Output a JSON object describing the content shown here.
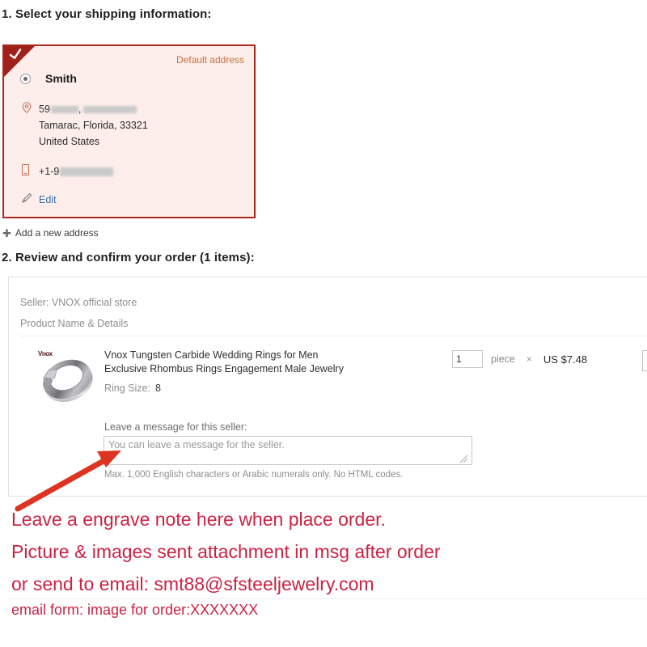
{
  "steps": {
    "step1_heading": "1. Select your shipping information:",
    "step2_heading": "2. Review and confirm your order (1 items):"
  },
  "address_card": {
    "default_badge": "Default address",
    "selected": true,
    "check_icon": "check-icon",
    "recipient": "Smith",
    "street_prefix": "59",
    "city_state_zip": "Tamarac, Florida, 33321",
    "country": "United States",
    "phone_prefix": "+1-9",
    "edit_label": "Edit",
    "location_icon": "location-pin-icon",
    "phone_icon": "mobile-phone-icon",
    "pencil_icon": "pencil-icon",
    "border_color": "#a82a1d",
    "background_color": "#fdeeec",
    "ribbon_color": "#a0201b",
    "badge_color": "#c8703c",
    "link_color": "#3b6ea8"
  },
  "add_address": {
    "label": "Add a new address",
    "icon": "plus-icon"
  },
  "order_panel": {
    "seller": "Seller: VNOX official store",
    "column_header": "Product Name & Details",
    "product": {
      "title": "Vnox Tungsten Carbide Wedding Rings for Men Exclusive Rhombus Rings Engagement Male Jewelry",
      "thumb_logo": "Vnox",
      "thumb_icon": "ring-product-image",
      "attribute_label": "Ring Size:",
      "attribute_value": "8",
      "quantity": "1",
      "unit": "piece",
      "multiply_symbol": "×",
      "price": "US $7.48"
    },
    "message": {
      "label": "Leave a message for this seller:",
      "placeholder": "You can leave a message for the seller.",
      "value": "",
      "hint": "Max. 1,000 English characters or Arabic numerals only. No HTML codes."
    }
  },
  "annotation": {
    "color": "#cc2244",
    "arrow_icon": "red-arrow-icon",
    "lines": [
      "Leave a engrave note here when place order.",
      "Picture & images sent attachment in msg after order",
      "or send to email: smt88@sfsteeljewelry.com"
    ],
    "footer": "email form: image for order:XXXXXXX"
  }
}
